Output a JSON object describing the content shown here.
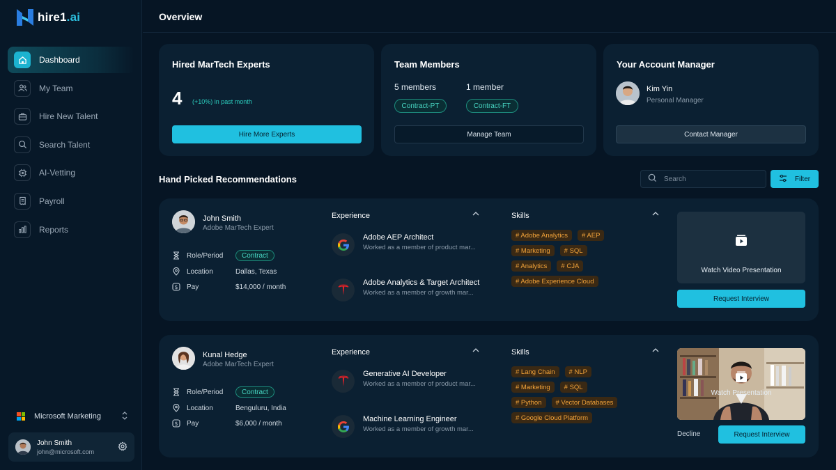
{
  "brand": {
    "name": "hire1",
    "suffix": ".ai"
  },
  "header": {
    "title": "Overview"
  },
  "sidebar": {
    "items": [
      {
        "label": "Dashboard",
        "icon": "home-icon",
        "active": true
      },
      {
        "label": "My Team",
        "icon": "team-icon"
      },
      {
        "label": "Hire New Talent",
        "icon": "briefcase-icon"
      },
      {
        "label": "Search Talent",
        "icon": "search-icon"
      },
      {
        "label": "AI-Vetting",
        "icon": "chip-icon"
      },
      {
        "label": "Payroll",
        "icon": "receipt-icon"
      },
      {
        "label": "Reports",
        "icon": "bar-chart-icon"
      }
    ],
    "org": "Microsoft Marketing",
    "user": {
      "name": "John Smith",
      "email": "john@microsoft.com"
    }
  },
  "cards": {
    "hired": {
      "title": "Hired MarTech Experts",
      "count": "4",
      "growth": "(+10%) in past month",
      "button": "Hire More Experts"
    },
    "team": {
      "title": "Team Members",
      "group1_count": "5 members",
      "group1_type": "Contract-PT",
      "group2_count": "1 member",
      "group2_type": "Contract-FT",
      "button": "Manage Team"
    },
    "manager": {
      "title": "Your Account Manager",
      "name": "Kim Yin",
      "role": "Personal Manager",
      "button": "Contact Manager"
    }
  },
  "recommendations": {
    "title": "Hand Picked Recommendations",
    "search_placeholder": "Search",
    "filter_label": "Filter",
    "labels": {
      "role": "Role/Period",
      "location": "Location",
      "pay": "Pay",
      "experience": "Experience",
      "skills": "Skills"
    },
    "items": [
      {
        "name": "John Smith",
        "title": "Adobe MarTech Expert",
        "role": "Contract",
        "location": "Dallas, Texas",
        "pay": "$14,000 / month",
        "experience": [
          {
            "title": "Adobe AEP Architect",
            "desc": "Worked as a member of product mar...",
            "logo": "google-logo-icon"
          },
          {
            "title": "Adobe Analytics & Target Architect",
            "desc": "Worked as a member of growth mar...",
            "logo": "tesla-logo-icon"
          }
        ],
        "skills": [
          [
            "# Adobe Analytics",
            "# AEP"
          ],
          [
            "# Marketing",
            "# SQL"
          ],
          [
            "# Analytics",
            "# CJA"
          ],
          [
            "# Adobe Experience Cloud"
          ]
        ],
        "video_label": "Watch Video Presentation",
        "action": "Request Interview"
      },
      {
        "name": "Kunal Hedge",
        "title": "Adobe MarTech Expert",
        "role": "Contract",
        "location": "Benguluru, India",
        "pay": "$6,000 / month",
        "experience": [
          {
            "title": "Generative AI Developer",
            "desc": "Worked as a member of product mar...",
            "logo": "tesla-logo-icon"
          },
          {
            "title": "Machine Learning Engineer",
            "desc": "Worked as a member of growth mar...",
            "logo": "google-logo-icon"
          }
        ],
        "skills": [
          [
            "# Lang Chain",
            "# NLP"
          ],
          [
            "# Marketing",
            "# SQL"
          ],
          [
            "# Python",
            "# Vector Databases"
          ],
          [
            "# Google Cloud Platform"
          ]
        ],
        "video_label": "Watch Presentation",
        "decline": "Decline",
        "action": "Request Interview"
      }
    ]
  },
  "colors": {
    "accent": "#20c0e0",
    "tag_text": "#f2a33a",
    "pill_text": "#48d6c3",
    "background": "#061524"
  }
}
